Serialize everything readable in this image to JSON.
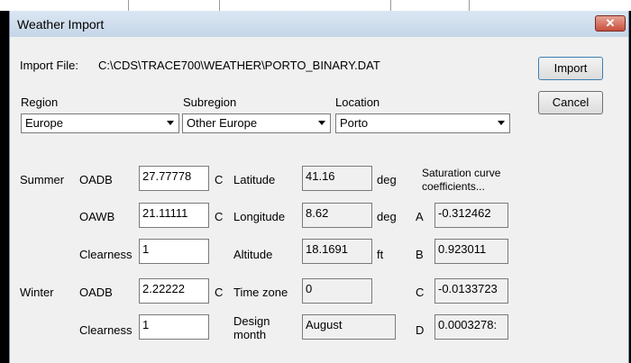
{
  "dialog": {
    "title": "Weather Import",
    "close_glyph": "✕"
  },
  "import_file": {
    "label": "Import File:",
    "path": "C:\\CDS\\TRACE700\\WEATHER\\PORTO_BINARY.DAT"
  },
  "buttons": {
    "import": "Import",
    "cancel": "Cancel"
  },
  "region": {
    "label": "Region",
    "value": "Europe"
  },
  "subregion": {
    "label": "Subregion",
    "value": "Other Europe"
  },
  "location": {
    "label": "Location",
    "value": "Porto"
  },
  "summer": {
    "label": "Summer",
    "oadb_label": "OADB",
    "oadb": "27.77778",
    "oawb_label": "OAWB",
    "oawb": "21.11111",
    "clearness_label": "Clearness",
    "clearness": "1"
  },
  "winter": {
    "label": "Winter",
    "oadb_label": "OADB",
    "oadb": "2.22222",
    "clearness_label": "Clearness",
    "clearness": "1"
  },
  "unit_c": "C",
  "geo": {
    "latitude_label": "Latitude",
    "latitude": "41.16",
    "latitude_unit": "deg",
    "longitude_label": "Longitude",
    "longitude": "8.62",
    "longitude_unit": "deg",
    "altitude_label": "Altitude",
    "altitude": "18.1691",
    "altitude_unit": "ft",
    "timezone_label": "Time zone",
    "timezone": "0",
    "design_month_label_1": "Design",
    "design_month_label_2": "month",
    "design_month": "August"
  },
  "saturation": {
    "title_1": "Saturation curve",
    "title_2": "coefficients...",
    "a_label": "A",
    "a": "-0.312462",
    "b_label": "B",
    "b": "0.923011",
    "c_label": "C",
    "c": "-0.0133723",
    "d_label": "D",
    "d": "0.0003278:"
  },
  "icons": {
    "close": "close-icon",
    "dropdown": "chevron-down-icon"
  }
}
